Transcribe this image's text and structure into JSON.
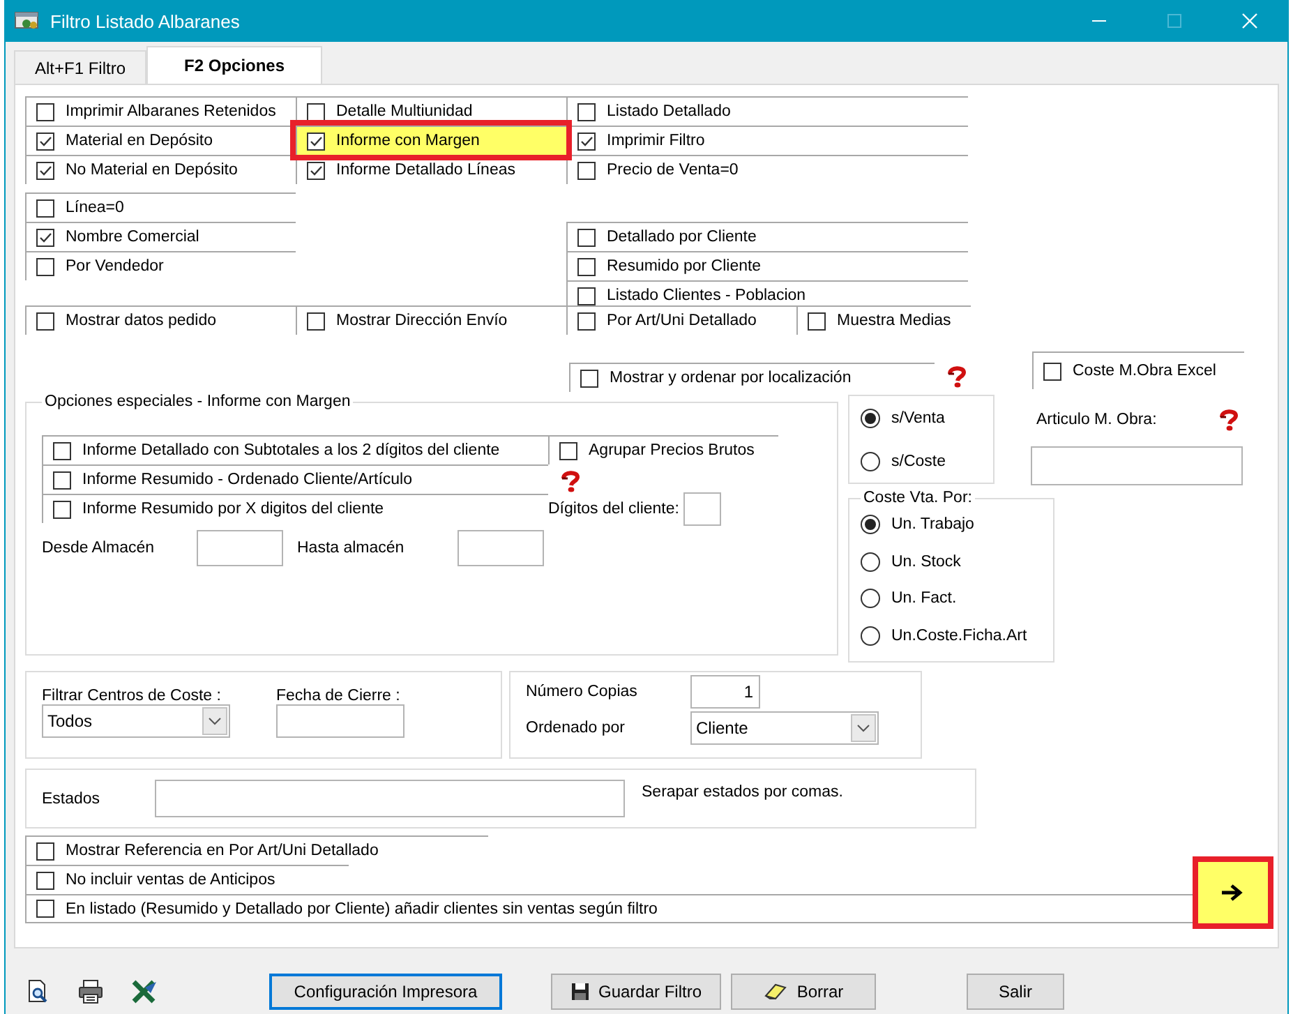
{
  "window": {
    "title": "Filtro Listado Albaranes",
    "controls": [
      {
        "kind": "minimize",
        "disabled": false
      },
      {
        "kind": "maximize",
        "disabled": true
      },
      {
        "kind": "close",
        "disabled": false
      }
    ]
  },
  "tabs": [
    {
      "label": "Alt+F1 Filtro",
      "selected": false
    },
    {
      "label": "F2 Opciones",
      "selected": true
    }
  ],
  "option_columns": [
    {
      "groups": [
        [
          {
            "label": "Imprimir Albaranes Retenidos",
            "checked": false,
            "highlighted": false
          },
          {
            "label": "Material en Depósito",
            "checked": true,
            "highlighted": false
          },
          {
            "label": "No Material en Depósito",
            "checked": true,
            "highlighted": false
          }
        ],
        [
          {
            "label": "Línea=0",
            "checked": false,
            "highlighted": false
          },
          {
            "label": "Nombre Comercial",
            "checked": true,
            "highlighted": false
          },
          {
            "label": "Por Vendedor",
            "checked": false,
            "highlighted": false
          }
        ]
      ]
    },
    {
      "groups": [
        [
          {
            "label": "Detalle Multiunidad",
            "checked": false,
            "highlighted": false
          },
          {
            "label": "Informe con Margen",
            "checked": true,
            "highlighted": true
          },
          {
            "label": "Informe Detallado Líneas",
            "checked": true,
            "highlighted": false
          }
        ]
      ]
    },
    {
      "groups": [
        [
          {
            "label": "Listado Detallado",
            "checked": false,
            "highlighted": false
          },
          {
            "label": "Imprimir Filtro",
            "checked": true,
            "highlighted": false
          },
          {
            "label": "Precio de Venta=0",
            "checked": false,
            "highlighted": false
          }
        ],
        [
          {
            "label": "Detallado por Cliente",
            "checked": false,
            "highlighted": false
          },
          {
            "label": "Resumido por Cliente",
            "checked": false,
            "highlighted": false
          },
          {
            "label": "Listado Clientes - Poblacion",
            "checked": false,
            "highlighted": false
          }
        ]
      ]
    }
  ],
  "option_bottom_row": [
    {
      "label": "Mostrar datos pedido",
      "checked": false
    },
    {
      "label": "Mostrar Dirección Envío",
      "checked": false
    },
    {
      "label": "Por Art/Uni Detallado",
      "checked": false
    },
    {
      "label": "Muestra Medias",
      "checked": false
    }
  ],
  "sort_by_location": {
    "label": "Mostrar y ordenar por localización",
    "checked": false
  },
  "labor_cost_excel": {
    "label": "Coste M.Obra Excel",
    "checked": false
  },
  "special_options": {
    "title": "Opciones especiales - Informe con Margen",
    "reports": [
      {
        "label": "Informe Detallado con Subtotales a los 2 dígitos del cliente",
        "checked": false
      },
      {
        "label": "Informe Resumido - Ordenado Cliente/Artículo",
        "checked": false
      },
      {
        "label": "Informe Resumido por X digitos del cliente",
        "checked": false
      }
    ],
    "group_gross_prices": {
      "label": "Agrupar Precios Brutos",
      "checked": false
    },
    "client_digits": {
      "label": "Dígitos del cliente:"
    },
    "warehouse_from": {
      "label": "Desde Almacén"
    },
    "warehouse_to": {
      "label": "Hasta almacén"
    }
  },
  "price_basis": [
    {
      "label": "s/Venta",
      "selected": true
    },
    {
      "label": "s/Coste",
      "selected": false
    }
  ],
  "sale_cost_by": {
    "title": "Coste Vta. Por:",
    "options": [
      {
        "label": "Un. Trabajo",
        "selected": true
      },
      {
        "label": "Un. Stock",
        "selected": false
      },
      {
        "label": "Un. Fact.",
        "selected": false
      },
      {
        "label": "Un.Coste.Ficha.Art",
        "selected": false
      }
    ]
  },
  "labor_item": {
    "label": "Articulo M. Obra:"
  },
  "cost_centers": {
    "label": "Filtrar Centros de Coste :",
    "value": "Todos"
  },
  "closing_date": {
    "label": "Fecha de Cierre :"
  },
  "copies": {
    "label": "Número Copias",
    "value": "1"
  },
  "order_by": {
    "label": "Ordenado por",
    "value": "Cliente"
  },
  "states": {
    "label": "Estados",
    "hint": "Serapar estados por comas."
  },
  "extra_options": [
    {
      "label": "Mostrar Referencia en Por Art/Uni Detallado",
      "checked": false
    },
    {
      "label": "No incluir ventas de Anticipos",
      "checked": false
    },
    {
      "label": "En listado (Resumido y Detallado por Cliente) añadir clientes sin ventas según filtro",
      "checked": false
    }
  ],
  "next_button": {
    "highlighted": true
  },
  "toolbar_icons": [
    {
      "kind": "preview"
    },
    {
      "kind": "print"
    },
    {
      "kind": "excel"
    }
  ],
  "buttons": [
    {
      "label": "Configuración Impresora",
      "kind": "plain",
      "focused": true
    },
    {
      "label": "Guardar Filtro",
      "kind": "save",
      "focused": false
    },
    {
      "label": "Borrar",
      "kind": "erase",
      "focused": false
    },
    {
      "label": "Salir",
      "kind": "plain",
      "focused": false
    }
  ]
}
